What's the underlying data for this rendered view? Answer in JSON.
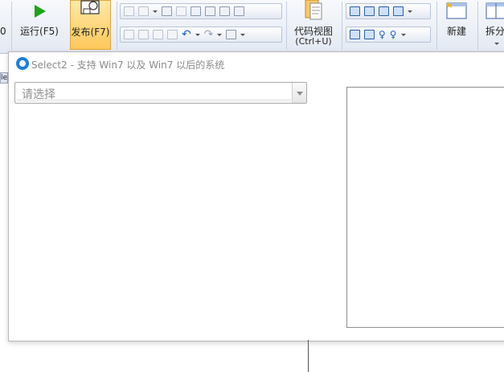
{
  "ribbon": {
    "cut_label": "0",
    "run": {
      "label": "运行(F5)",
      "icon": "play-icon",
      "color": "#1aa51a"
    },
    "publish": {
      "label": "发布(F7)",
      "icon": "publish-icon"
    },
    "code_view": {
      "label": "代码视图",
      "shortcut": "(Ctrl+U)",
      "icon": "code-view-icon"
    },
    "new": {
      "label": "新建",
      "icon": "new-window-icon"
    },
    "split": {
      "label": "拆分",
      "icon": "split-icon"
    }
  },
  "dialog": {
    "title": "Select2 - 支持 Win7 以及 Win7 以后的系统",
    "select_placeholder": "请选择",
    "left_edge_text": "lec"
  }
}
